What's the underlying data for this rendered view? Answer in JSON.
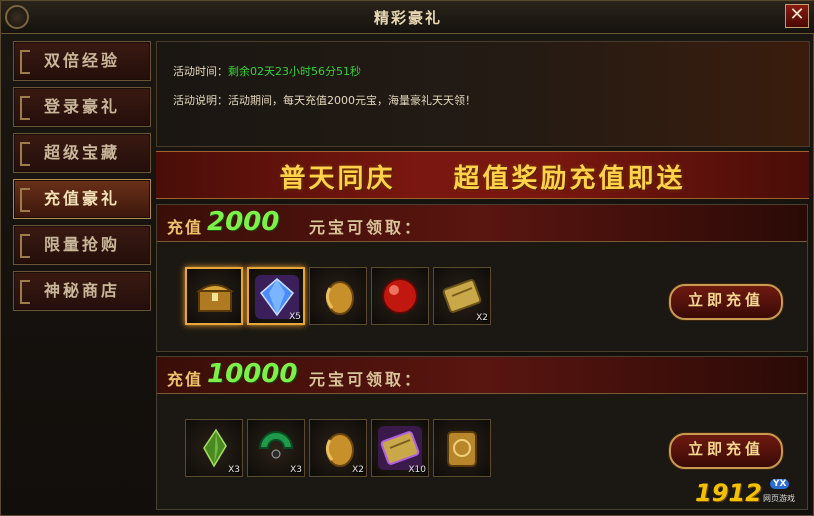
{
  "window": {
    "title": "精彩豪礼",
    "close_label": "✕"
  },
  "sidebar": {
    "items": [
      {
        "label": "双倍经验",
        "active": false
      },
      {
        "label": "登录豪礼",
        "active": false
      },
      {
        "label": "超级宝藏",
        "active": false
      },
      {
        "label": "充值豪礼",
        "active": true
      },
      {
        "label": "限量抢购",
        "active": false
      },
      {
        "label": "神秘商店",
        "active": false
      }
    ]
  },
  "info": {
    "time_label": "活动时间：",
    "time_value": "剩余02天23小时56分51秒",
    "desc_label": "活动说明：",
    "desc_value": "活动期间，每天充值2000元宝，海量豪礼天天领！"
  },
  "banner": {
    "text": "普天同庆　　超值奖励充值即送"
  },
  "tiers": [
    {
      "label": "充值",
      "amount": "2000",
      "suffix": "元宝可领取：",
      "button_label": "立即充值",
      "rewards": [
        {
          "icon": "treasure-chest-icon",
          "qty": "",
          "highlight": true
        },
        {
          "icon": "blue-gem-icon",
          "qty": "X5",
          "highlight": true
        },
        {
          "icon": "gold-orb-icon",
          "qty": "",
          "highlight": false
        },
        {
          "icon": "red-orb-icon",
          "qty": "",
          "highlight": false
        },
        {
          "icon": "scroll-icon",
          "qty": "X2",
          "highlight": false
        }
      ]
    },
    {
      "label": "充值",
      "amount": "10000",
      "suffix": "元宝可领取：",
      "button_label": "立即充值",
      "rewards": [
        {
          "icon": "green-crystal-icon",
          "qty": "X3",
          "highlight": false
        },
        {
          "icon": "jade-disc-icon",
          "qty": "X3",
          "highlight": false
        },
        {
          "icon": "gold-orb-icon",
          "qty": "X2",
          "highlight": false
        },
        {
          "icon": "purple-scroll-icon",
          "qty": "X10",
          "highlight": false
        },
        {
          "icon": "gold-token-icon",
          "qty": "",
          "highlight": false
        }
      ]
    }
  ],
  "watermark": {
    "number": "1912",
    "badge": "YX",
    "sub": "网页游戏"
  },
  "colors": {
    "accent_gold": "#ffd24a",
    "amount_green": "#7df14a",
    "time_green": "#33d233"
  }
}
